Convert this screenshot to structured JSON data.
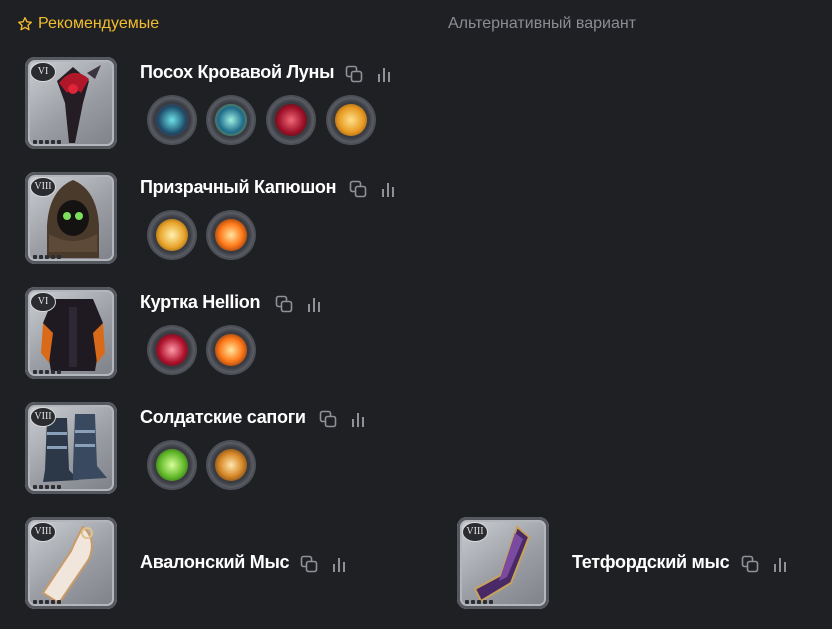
{
  "tabs": {
    "recommended": "Рекомендуемые",
    "alternative": "Альтернативный вариант"
  },
  "items": [
    {
      "tier": "VI",
      "name": "Посох Кровавой Луны"
    },
    {
      "tier": "VIII",
      "name": "Призрачный Капюшон"
    },
    {
      "tier": "VI",
      "name": "Куртка Hellion"
    },
    {
      "tier": "VIII",
      "name": "Солдатские сапоги"
    },
    {
      "tier": "VIII",
      "name": "Авалонский Мыс"
    },
    {
      "tier": "VIII",
      "name": "Тетфордский мыс"
    }
  ],
  "icons": {
    "copy": "copy-icon",
    "stats": "stats-bars-icon",
    "star": "star-outline-icon"
  },
  "colors": {
    "background": "#1f2024",
    "accent": "#f2bd2d",
    "muted_tab": "#8b8d93",
    "icon": "#8f9197"
  }
}
